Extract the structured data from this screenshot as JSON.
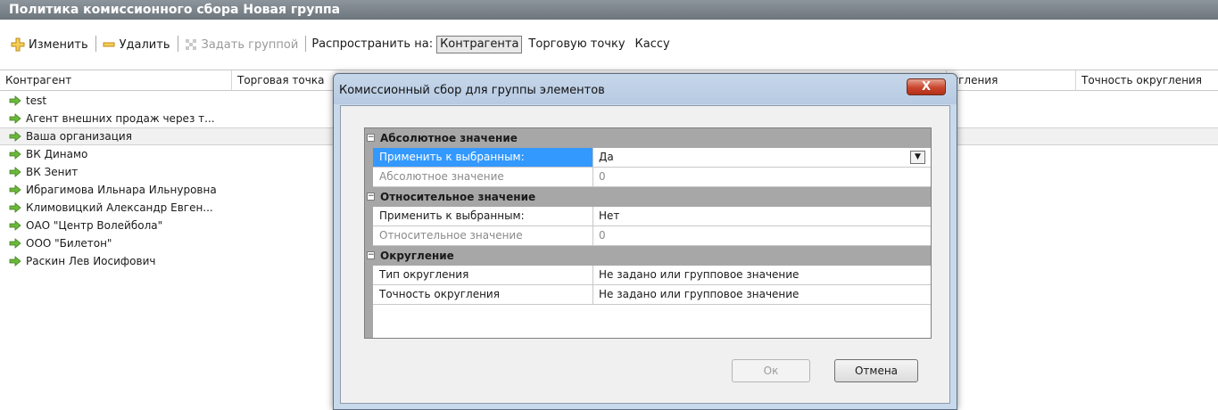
{
  "window": {
    "title": "Политика комиссионного сбора Новая группа"
  },
  "toolbar": {
    "edit_label": "Изменить",
    "delete_label": "Удалить",
    "group_label": "Задать группой",
    "spread_label": "Распространить на:",
    "spread_options": [
      "Контрагента",
      "Торговую точку",
      "Кассу"
    ],
    "spread_selected": "Контрагента"
  },
  "grid": {
    "columns": [
      "Контрагент",
      "Торговая точка",
      "",
      "",
      "угления",
      "Точность округления"
    ],
    "rows": [
      "test",
      "Агент внешних продаж через т...",
      "Ваша организация",
      "ВК Динамо",
      "ВК Зенит",
      "Ибрагимова Ильнара Ильнуровна",
      "Климовицкий Александр Евген...",
      "ОАО \"Центр Волейбола\"",
      "ООО \"Билетон\"",
      "Раскин Лев Иосифович"
    ],
    "selected_row": "Ваша организация"
  },
  "dialog": {
    "title": "Комиссионный сбор для группы элементов",
    "close_label": "X",
    "categories": [
      {
        "label": "Абсолютное значение",
        "props": [
          {
            "name": "Применить к выбранным:",
            "value": "Да"
          },
          {
            "name": "Абсолютное значение",
            "value": "0"
          }
        ]
      },
      {
        "label": "Относительное значение",
        "props": [
          {
            "name": "Применить к выбранным:",
            "value": "Нет"
          },
          {
            "name": "Относительное значение",
            "value": "0"
          }
        ]
      },
      {
        "label": "Округление",
        "props": [
          {
            "name": "Тип округления",
            "value": "Не задано или групповое значение"
          },
          {
            "name": "Точность округления",
            "value": "Не задано или групповое значение"
          }
        ]
      }
    ],
    "ok_label": "Ок",
    "cancel_label": "Отмена"
  },
  "colors": {
    "titlebar": "#7a8289",
    "selection": "#3399ff",
    "close": "#c9452e",
    "arrow": "#5aa62a"
  },
  "icons": [
    "add-icon",
    "delete-icon",
    "group-icon",
    "arrow-right-icon",
    "close-icon",
    "collapse-icon",
    "dropdown-icon"
  ]
}
